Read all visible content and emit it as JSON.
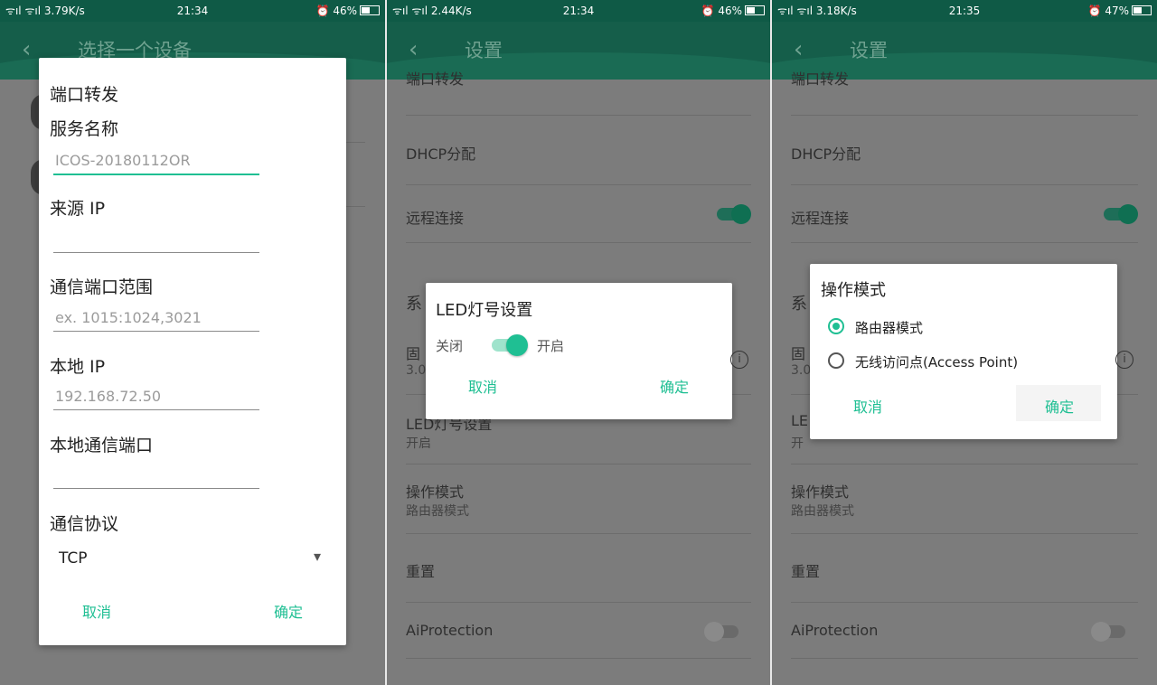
{
  "panels": [
    {
      "status": {
        "signal": "ᯤıl ᯤıl",
        "speed": "3.79K/s",
        "time": "21:34",
        "battery": "46%"
      },
      "appbar": {
        "title": "选择一个设备"
      },
      "dialog": {
        "heading": "端口转发",
        "fields": [
          {
            "label": "服务名称",
            "value": "ICOS-20180112OR"
          },
          {
            "label": "来源 IP",
            "value": ""
          },
          {
            "label": "通信端口范围",
            "placeholder": "ex. 1015:1024,3021"
          },
          {
            "label": "本地 IP",
            "placeholder": "192.168.72.50"
          },
          {
            "label": "本地通信端口",
            "value": ""
          }
        ],
        "protocol_label": "通信协议",
        "protocol_value": "TCP",
        "cancel": "取消",
        "ok": "确定"
      }
    },
    {
      "status": {
        "signal": "ᯤıl ᯤıl",
        "speed": "2.44K/s",
        "time": "21:34",
        "battery": "46%"
      },
      "appbar": {
        "title": "设置"
      },
      "list": {
        "r0": "端口转发",
        "r1": "DHCP分配",
        "r2": "远程连接",
        "r3": "系",
        "r4_title": "固",
        "r4_sub": "3.0",
        "r5_title": "LED灯号设置",
        "r5_sub": "开启",
        "r6_title": "操作模式",
        "r6_sub": "路由器模式",
        "r7": "重置",
        "r8": "AiProtection"
      },
      "dialog": {
        "title": "LED灯号设置",
        "off_label": "关闭",
        "on_label": "开启",
        "cancel": "取消",
        "ok": "确定"
      }
    },
    {
      "status": {
        "signal": "ᯤıl ᯤıl",
        "speed": "3.18K/s",
        "time": "21:35",
        "battery": "47%"
      },
      "appbar": {
        "title": "设置"
      },
      "list": {
        "r0": "端口转发",
        "r1": "DHCP分配",
        "r2": "远程连接",
        "r3": "系",
        "r4_title": "固",
        "r4_sub": "3.0",
        "r5_title": "LE",
        "r5_sub": "开",
        "r6_title": "操作模式",
        "r6_sub": "路由器模式",
        "r7": "重置",
        "r8": "AiProtection"
      },
      "dialog": {
        "title": "操作模式",
        "options": [
          "路由器模式",
          "无线访问点(Access Point)"
        ],
        "cancel": "取消",
        "ok": "确定"
      }
    }
  ],
  "icons": {
    "back": "‹",
    "dropdown": "▾",
    "info": "i"
  }
}
